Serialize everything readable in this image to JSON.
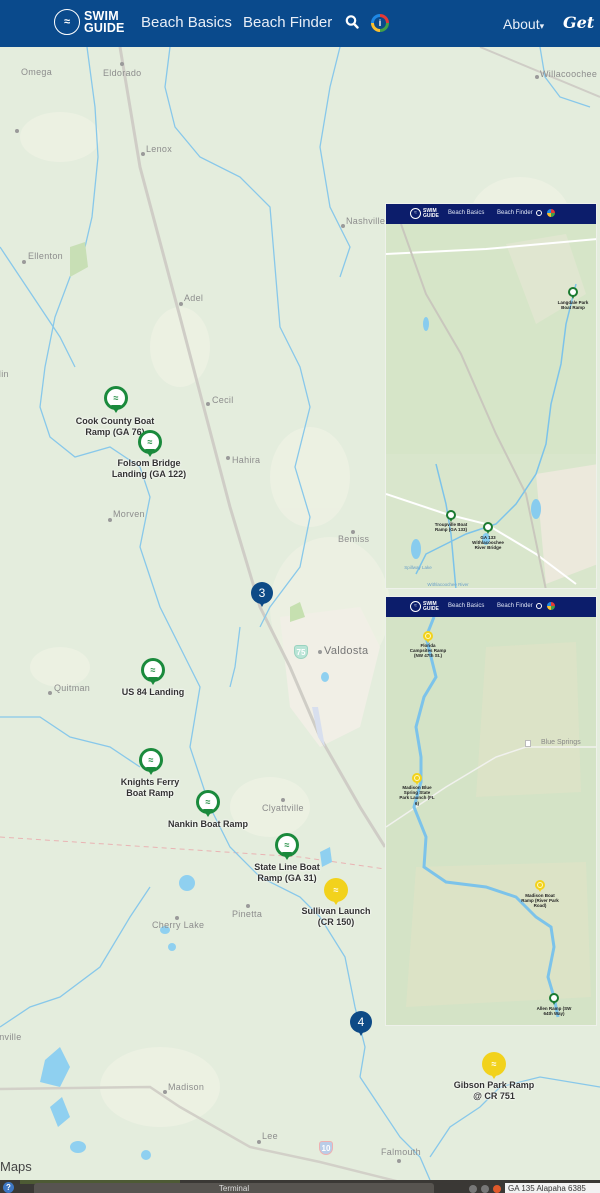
{
  "header": {
    "logo_line1": "SWIM",
    "logo_line2": "GUIDE",
    "logo_icon": "swimmer-icon",
    "nav": [
      "Beach Basics",
      "Beach Finder"
    ],
    "search_icon": "search-icon",
    "info_icon": "info-icon",
    "about_label": "About",
    "about_caret": "▾",
    "cta_label": "Get the"
  },
  "map": {
    "attribution": "Maps",
    "towns": [
      {
        "name": "Omega"
      },
      {
        "name": "Eldorado"
      },
      {
        "name": "Willacoochee"
      },
      {
        "name": "Lenox"
      },
      {
        "name": "Nashville"
      },
      {
        "name": "Ellenton"
      },
      {
        "name": "Adel"
      },
      {
        "name": "Berlin"
      },
      {
        "name": "Cecil"
      },
      {
        "name": "Hahira"
      },
      {
        "name": "Morven"
      },
      {
        "name": "Bemiss"
      },
      {
        "name": "Valdosta"
      },
      {
        "name": "Quitman"
      },
      {
        "name": "Clyattville"
      },
      {
        "name": "Pinetta"
      },
      {
        "name": "Cherry Lake"
      },
      {
        "name": "Madison"
      },
      {
        "name": "Greenville"
      },
      {
        "name": "Lee"
      },
      {
        "name": "Falmouth"
      }
    ],
    "highway_shields": [
      {
        "label": "75"
      },
      {
        "label": "10"
      }
    ],
    "pins": [
      {
        "name": "Cook County Boat Ramp (GA 76)",
        "lines": [
          "Cook County Boat",
          "Ramp (GA 76)"
        ],
        "status": "green"
      },
      {
        "name": "Folsom Bridge Landing (GA 122)",
        "lines": [
          "Folsom Bridge",
          "Landing (GA 122)"
        ],
        "status": "green"
      },
      {
        "name": "US 84 Landing",
        "lines": [
          "US 84 Landing"
        ],
        "status": "green"
      },
      {
        "name": "Knights Ferry Boat Ramp",
        "lines": [
          "Knights Ferry",
          "Boat Ramp"
        ],
        "status": "green"
      },
      {
        "name": "Nankin Boat Ramp",
        "lines": [
          "Nankin Boat Ramp"
        ],
        "status": "green"
      },
      {
        "name": "State Line Boat Ramp (GA 31)",
        "lines": [
          "State Line Boat",
          "Ramp (GA 31)"
        ],
        "status": "green"
      },
      {
        "name": "Sullivan Launch (CR 150)",
        "lines": [
          "Sullivan Launch",
          "(CR 150)"
        ],
        "status": "yellow"
      },
      {
        "name": "Gibson Park Ramp @ CR 751",
        "lines": [
          "Gibson Park Ramp",
          "@ CR 751"
        ],
        "status": "yellow"
      }
    ],
    "clusters": [
      {
        "count": "3"
      },
      {
        "count": "4"
      }
    ],
    "status_colors": {
      "green": "#1a8a3c",
      "yellow": "#f2d21c",
      "cluster": "#0d4a86"
    }
  },
  "insets": [
    {
      "nav": [
        "Beach Basics",
        "Beach Finder"
      ],
      "logo_line1": "SWIM",
      "logo_line2": "GUIDE",
      "pins": [
        {
          "lines": [
            "Langdale Park",
            "Boat Ramp"
          ],
          "status": "green"
        },
        {
          "lines": [
            "Troupville Boat",
            "Ramp (GA 133)"
          ],
          "status": "green"
        },
        {
          "lines": [
            "GA 133",
            "Withlacoochee",
            "River Bridge"
          ],
          "status": "green"
        }
      ],
      "places": [
        "Withlacoochee River",
        "Spillway Lake"
      ]
    },
    {
      "nav": [
        "Beach Basics",
        "Beach Finder"
      ],
      "logo_line1": "SWIM",
      "logo_line2": "GUIDE",
      "pins": [
        {
          "lines": [
            "Florida",
            "Campsites Ramp",
            "(NW 47th St.)"
          ],
          "status": "yellow"
        },
        {
          "lines": [
            "Madison Blue",
            "Spring State",
            "Park Launch (FL",
            "6)"
          ],
          "status": "yellow"
        },
        {
          "lines": [
            "Madison Boat",
            "Ramp (River Park",
            "Road)"
          ],
          "status": "yellow"
        },
        {
          "lines": [
            "Allen Ramp (SW",
            "64th Way)"
          ],
          "status": "green"
        }
      ],
      "places": [
        "Blue Springs"
      ]
    }
  ],
  "taskbar": {
    "help_label": "?",
    "terminal_title": "Terminal",
    "right_text": "GA 135 Alapaha 6385"
  }
}
